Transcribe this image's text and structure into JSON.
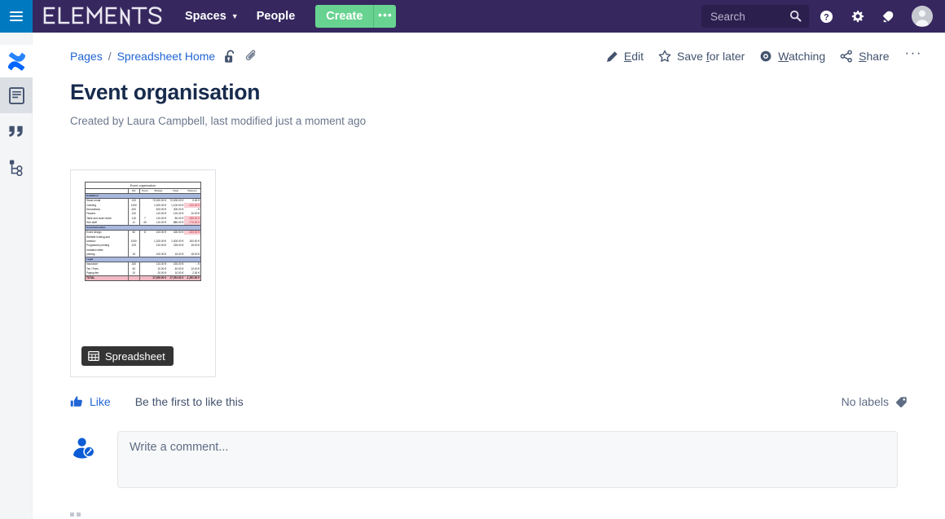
{
  "topnav": {
    "menu_icon": "hamburger-icon",
    "brand": "ELEMENTS",
    "spaces_label": "Spaces",
    "people_label": "People",
    "create_label": "Create",
    "create_more_label": "•••",
    "search_placeholder": "Search",
    "search_value": "",
    "help_icon": "help-icon",
    "settings_icon": "gear-icon",
    "notifications_icon": "bell-icon",
    "avatar_icon": "user-avatar-icon",
    "bg_color": "#36275f",
    "accent_green": "#68d391",
    "menu_blue": "#0079c1"
  },
  "rail": {
    "logo_name": "confluence-logo-icon",
    "items": [
      {
        "name": "sidebar-item-page",
        "icon": "page-icon",
        "active": true
      },
      {
        "name": "sidebar-item-blog",
        "icon": "quote-icon",
        "active": false
      },
      {
        "name": "sidebar-item-page-tree",
        "icon": "page-tree-icon",
        "active": false
      }
    ]
  },
  "breadcrumb": {
    "items": [
      {
        "label": "Pages",
        "name": "breadcrumb-pages"
      },
      {
        "label": "Spreadsheet Home",
        "name": "breadcrumb-spreadsheet-home"
      }
    ],
    "separator": "/",
    "restrictions_icon": "unlock-icon",
    "attachments_icon": "paperclip-icon"
  },
  "page_actions": {
    "edit": {
      "label_pre": "",
      "label_key": "E",
      "label_post": "dit",
      "icon": "pencil-icon"
    },
    "save_for_later": {
      "label_pre": "Save ",
      "label_key": "f",
      "label_post": "or later",
      "icon": "star-icon"
    },
    "watching": {
      "label_pre": "",
      "label_key": "W",
      "label_post": "atching",
      "icon": "eye-icon"
    },
    "share": {
      "label_pre": "",
      "label_key": "S",
      "label_post": "hare",
      "icon": "share-icon"
    },
    "more": "···"
  },
  "page": {
    "title": "Event organisation",
    "meta": "Created by Laura Campbell, last modified just a moment ago"
  },
  "attachment": {
    "badge_label": "Spreadsheet",
    "badge_icon": "table-icon",
    "preview_title": "Event organisation"
  },
  "footer": {
    "like_label": "Like",
    "like_icon": "thumbs-up-icon",
    "like_status": "Be the first to like this",
    "labels_label": "No labels",
    "labels_icon": "tag-icon"
  },
  "comment": {
    "avatar_icon": "user-edit-avatar-icon",
    "placeholder": "Write a comment..."
  },
  "chart_data": {
    "type": "table",
    "title": "Event organisation",
    "columns": [
      "",
      "Nbr",
      "Hours",
      "Budget",
      "Real",
      "Balance"
    ],
    "rows": [
      {
        "kind": "section",
        "cells": [
          "Exhibition",
          "",
          "",
          "",
          "",
          ""
        ]
      },
      {
        "kind": "data",
        "cells": [
          "Stand rental",
          "130",
          "",
          "72,000.00 €",
          "72,000.00 €",
          "0.00 €"
        ]
      },
      {
        "kind": "data",
        "cells": [
          "Catering",
          "1100",
          "",
          "1,000.00 €",
          "1,100.00 €",
          "-100.00 €"
        ],
        "neg": 5
      },
      {
        "kind": "data",
        "cells": [
          "Decorations",
          "400",
          "",
          "400.00 €",
          "400.00 €",
          "-   €"
        ]
      },
      {
        "kind": "data",
        "cells": [
          "Flowers",
          "120",
          "",
          "110.00 €",
          "120.00 €",
          "10.00 €"
        ]
      },
      {
        "kind": "data",
        "cells": [
          "Table and chair rental",
          "115",
          "7",
          "110.00 €",
          "80.00 €",
          "-955.00 €"
        ],
        "neg": 5
      },
      {
        "kind": "data",
        "cells": [
          "Hire staff",
          "11",
          "40",
          "110.00 €",
          "880.00 €",
          "-770.00 €"
        ],
        "neg": 5
      },
      {
        "kind": "section",
        "cells": [
          "Communication",
          "",
          "",
          "",
          "",
          ""
        ]
      },
      {
        "kind": "data",
        "cells": [
          "Event design",
          "50",
          "8",
          "100.00 €",
          "400.00 €",
          "-300.00 €"
        ],
        "neg": 5
      },
      {
        "kind": "data",
        "cells": [
          "Website hosting and",
          "",
          "",
          "",
          "",
          ""
        ]
      },
      {
        "kind": "data",
        "cells": [
          "creation",
          "1000",
          "",
          "1,200.00 €",
          "1,000.00 €",
          "200.00 €"
        ]
      },
      {
        "kind": "data",
        "cells": [
          "Programme printing",
          "225",
          "",
          "210.00 €",
          "225.00 €",
          "15.00 €"
        ]
      },
      {
        "kind": "data",
        "cells": [
          "Invitation letter",
          "",
          "",
          "",
          "",
          ""
        ]
      },
      {
        "kind": "data",
        "cells": [
          "printing",
          "15",
          "",
          "100.00 €",
          "15.00 €",
          "15.00 €"
        ]
      },
      {
        "kind": "section",
        "cells": [
          "Legal",
          "",
          "",
          "",
          "",
          ""
        ]
      },
      {
        "kind": "data",
        "cells": [
          "Insurance",
          "150",
          "",
          "110.00 €",
          "150.00 €",
          "-   €"
        ]
      },
      {
        "kind": "data",
        "cells": [
          "Tax / Fees",
          "40",
          "",
          "10.00 €",
          "40.00 €",
          "10.00 €"
        ]
      },
      {
        "kind": "data",
        "cells": [
          "Paying fee",
          "10",
          "",
          "20.00 €",
          "10.00 €",
          "2.00 €"
        ]
      },
      {
        "kind": "total",
        "cells": [
          "TOTAL",
          "",
          "",
          "17,200.00 €",
          "17,291.00 €",
          "-1,291.00 €"
        ],
        "neg": 5
      }
    ]
  }
}
